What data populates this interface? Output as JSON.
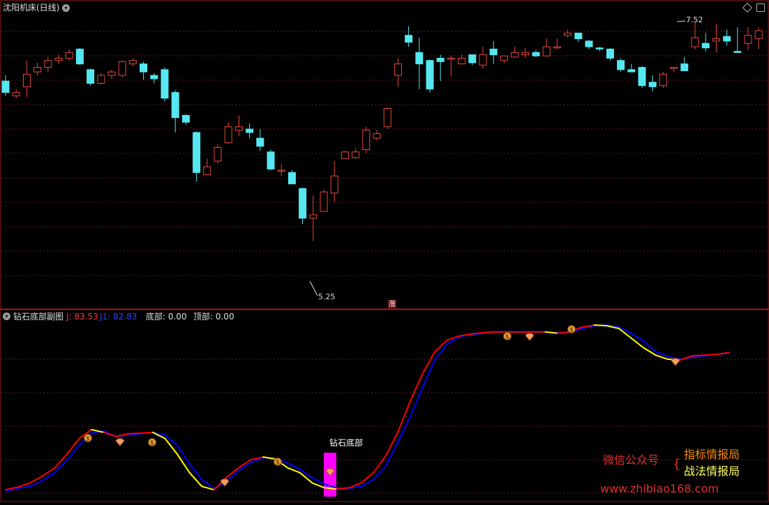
{
  "main_panel": {
    "title": "沈阳机床(日线)",
    "high_label": "7.52",
    "low_label": "5.25",
    "zhang_marker": "涨"
  },
  "sub_panel": {
    "title": "钻石底部副图",
    "j_label": "J: 83.53",
    "j1_label": "J1: 82.83",
    "bottom_label": "底部: 0.00",
    "top_label": "顶部: 0.00",
    "signal_label": "钻石底部"
  },
  "watermark": {
    "left": "微信公众号",
    "right_top": "指标情报局",
    "right_bottom": "战法情报局",
    "url": "www.zhibiao168.com"
  },
  "colors": {
    "up": "#e8483d",
    "down": "#55e8f0",
    "grid": "#6b1a1a",
    "j_line": "#ff0000",
    "j1_line": "#0000ff",
    "turn_up": "#00ff00",
    "turn_down": "#ffff00",
    "signal_bar": "#ff00ff"
  },
  "chart_data": [
    {
      "type": "candlestick",
      "title": "沈阳机床(日线)",
      "y_max_label": 7.52,
      "y_min_label": 5.25,
      "candles": [
        [
          7.0,
          6.9,
          7.05,
          6.87
        ],
        [
          6.87,
          6.9,
          6.93,
          6.85
        ],
        [
          6.95,
          7.06,
          7.18,
          6.86
        ],
        [
          7.08,
          7.12,
          7.16,
          7.05
        ],
        [
          7.12,
          7.18,
          7.21,
          7.08
        ],
        [
          7.18,
          7.2,
          7.23,
          7.15
        ],
        [
          7.2,
          7.25,
          7.28,
          7.18
        ],
        [
          7.28,
          7.15,
          7.29,
          7.14
        ],
        [
          7.1,
          6.98,
          7.11,
          6.96
        ],
        [
          6.98,
          7.05,
          7.07,
          6.97
        ],
        [
          7.05,
          7.08,
          7.1,
          7.02
        ],
        [
          7.05,
          7.17,
          7.18,
          7.03
        ],
        [
          7.15,
          7.18,
          7.2,
          7.13
        ],
        [
          7.15,
          7.08,
          7.17,
          7.01
        ],
        [
          7.05,
          7.02,
          7.07,
          6.98
        ],
        [
          7.1,
          6.85,
          7.12,
          6.82
        ],
        [
          6.9,
          6.68,
          6.92,
          6.55
        ],
        [
          6.7,
          6.64,
          6.71,
          6.62
        ],
        [
          6.55,
          6.2,
          6.56,
          6.12
        ],
        [
          6.18,
          6.25,
          6.32,
          6.18
        ],
        [
          6.3,
          6.42,
          6.45,
          6.28
        ],
        [
          6.46,
          6.6,
          6.64,
          6.45
        ],
        [
          6.57,
          6.6,
          6.7,
          6.52
        ],
        [
          6.58,
          6.55,
          6.63,
          6.5
        ],
        [
          6.5,
          6.43,
          6.58,
          6.39
        ],
        [
          6.38,
          6.23,
          6.4,
          6.22
        ],
        [
          6.22,
          6.22,
          6.27,
          6.17
        ],
        [
          6.2,
          6.1,
          6.22,
          6.1
        ],
        [
          6.06,
          5.8,
          6.07,
          5.75
        ],
        [
          5.8,
          5.83,
          6.0,
          5.6
        ],
        [
          5.86,
          6.03,
          6.05,
          5.88
        ],
        [
          6.02,
          6.17,
          6.3,
          5.94
        ],
        [
          6.32,
          6.38,
          6.39,
          6.32
        ],
        [
          6.33,
          6.38,
          6.41,
          6.32
        ],
        [
          6.4,
          6.57,
          6.6,
          6.37
        ],
        [
          6.5,
          6.54,
          6.57,
          6.48
        ],
        [
          6.6,
          6.76,
          6.77,
          6.58
        ],
        [
          7.05,
          7.15,
          7.2,
          6.95
        ],
        [
          7.4,
          7.34,
          7.48,
          7.3
        ],
        [
          7.25,
          7.15,
          7.38,
          6.93
        ],
        [
          7.18,
          6.93,
          7.19,
          6.9
        ],
        [
          7.2,
          7.17,
          7.23,
          7.0
        ],
        [
          7.2,
          7.2,
          7.22,
          7.04
        ],
        [
          7.15,
          7.2,
          7.23,
          7.15
        ],
        [
          7.23,
          7.16,
          7.22,
          7.14
        ],
        [
          7.14,
          7.23,
          7.3,
          7.11
        ],
        [
          7.28,
          7.23,
          7.35,
          7.15
        ],
        [
          7.18,
          7.22,
          7.22,
          7.16
        ],
        [
          7.21,
          7.25,
          7.3,
          7.2
        ],
        [
          7.23,
          7.25,
          7.29,
          7.2
        ],
        [
          7.25,
          7.22,
          7.27,
          7.21
        ],
        [
          7.22,
          7.3,
          7.37,
          7.22
        ],
        [
          7.29,
          7.3,
          7.37,
          7.28
        ],
        [
          7.4,
          7.42,
          7.45,
          7.38
        ],
        [
          7.42,
          7.37,
          7.42,
          7.34
        ],
        [
          7.35,
          7.3,
          7.36,
          7.28
        ],
        [
          7.29,
          7.28,
          7.3,
          7.26
        ],
        [
          7.28,
          7.2,
          7.29,
          7.18
        ],
        [
          7.18,
          7.1,
          7.2,
          7.08
        ],
        [
          7.1,
          7.08,
          7.15,
          7.08
        ],
        [
          7.12,
          6.96,
          7.13,
          6.94
        ],
        [
          6.99,
          6.95,
          7.05,
          6.91
        ],
        [
          6.96,
          7.06,
          7.08,
          6.94
        ],
        [
          7.11,
          7.12,
          7.12,
          7.08
        ],
        [
          7.15,
          7.09,
          7.21,
          7.1
        ],
        [
          7.3,
          7.38,
          7.52,
          7.28
        ],
        [
          7.33,
          7.29,
          7.42,
          7.26
        ],
        [
          7.35,
          7.37,
          7.5,
          7.25
        ],
        [
          7.39,
          7.35,
          7.45,
          7.31
        ],
        [
          7.26,
          7.25,
          7.47,
          7.25
        ],
        [
          7.33,
          7.4,
          7.47,
          7.27
        ],
        [
          7.37,
          7.44,
          7.47,
          7.28
        ]
      ]
    },
    {
      "type": "line",
      "title": "钻石底部副图",
      "series": [
        {
          "name": "J",
          "values": [
            10,
            14,
            20,
            30,
            42,
            62,
            85,
            98,
            94,
            88,
            92,
            93,
            94,
            85,
            62,
            35,
            15,
            10,
            28,
            42,
            54,
            58,
            55,
            42,
            35,
            20,
            13,
            11,
            13,
            20,
            35,
            60,
            95,
            140,
            180,
            212,
            229,
            235,
            238,
            240,
            241,
            241,
            241,
            241,
            241,
            239,
            241,
            248,
            251,
            250,
            246,
            232,
            218,
            207,
            201,
            200,
            206,
            207,
            208,
            211
          ]
        },
        {
          "name": "J1",
          "values": [
            8,
            12,
            15,
            23,
            35,
            53,
            75,
            93,
            96,
            88,
            90,
            92,
            94,
            90,
            75,
            48,
            25,
            12,
            22,
            38,
            50,
            57,
            56,
            49,
            40,
            28,
            18,
            13,
            12,
            15,
            25,
            45,
            80,
            117,
            160,
            200,
            223,
            234,
            237,
            239,
            241,
            241,
            241,
            241,
            241,
            240,
            240,
            246,
            250,
            251,
            248,
            239,
            228,
            212,
            205,
            201,
            204,
            206,
            208,
            210
          ]
        }
      ]
    }
  ]
}
